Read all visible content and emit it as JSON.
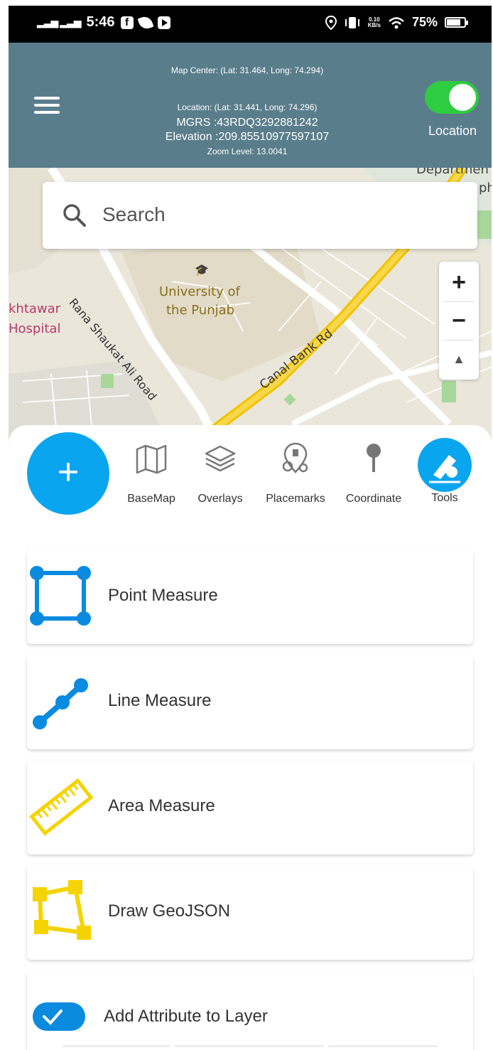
{
  "status_bar": {
    "time": "5:46",
    "signal": "..ıl ..ıl",
    "net_speed_top": "0.10",
    "net_speed_unit": "KB/s",
    "battery": "75%"
  },
  "header": {
    "map_center": "Map Center: (Lat: 31.464, Long: 74.294)",
    "location": "Location: (Lat: 31.441, Long: 74.296)",
    "mgrs": "MGRS :43RDQ3292881242",
    "elevation": "Elevation :209.85510977597107",
    "zoom_level": "Zoom Level: 13.0041",
    "location_toggle_label": "Location",
    "location_toggle_on": true
  },
  "map": {
    "search_placeholder": "Search",
    "labels": {
      "university": "University of",
      "university2": "the Punjab",
      "road1": "Rana Shaukat Ali Road",
      "road2": "Canal Bank Rd",
      "hospital1": "khtawar",
      "hospital2": "Hospital",
      "dept1": "Departmen",
      "dept2": "ph"
    },
    "zoom_in": "+",
    "zoom_out": "−",
    "compass": "▲"
  },
  "tabs": [
    {
      "label": "BaseMap",
      "icon": "map-icon"
    },
    {
      "label": "Overlays",
      "icon": "layers-icon"
    },
    {
      "label": "Placemarks",
      "icon": "placemarks-icon"
    },
    {
      "label": "Coordinate",
      "icon": "pin-icon"
    },
    {
      "label": "Tools",
      "icon": "tools-icon",
      "active": true
    }
  ],
  "fab": "+",
  "tools": [
    {
      "label": "Point Measure",
      "icon": "square-points-icon"
    },
    {
      "label": "Line Measure",
      "icon": "line-measure-icon"
    },
    {
      "label": "Area Measure",
      "icon": "ruler-icon"
    },
    {
      "label": "Draw GeoJSON",
      "icon": "polygon-icon"
    },
    {
      "label": "Add Attribute to Layer",
      "icon": "checkbox-toggle-icon"
    }
  ],
  "colors": {
    "header": "#5a7d8c",
    "accent": "#0aa5ef",
    "toggle": "#2ecc40",
    "yellow": "#f5d300"
  }
}
